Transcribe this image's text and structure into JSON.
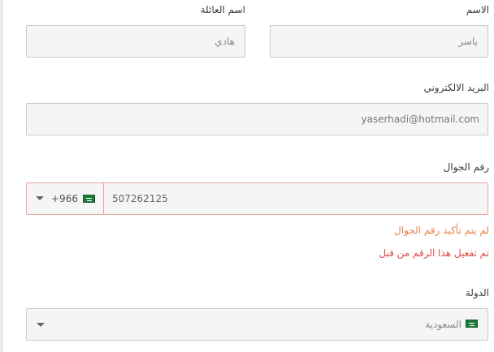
{
  "form": {
    "first_name": {
      "label": "الاسم",
      "value": "ياسر"
    },
    "last_name": {
      "label": "اسم العائلة",
      "value": "هادي"
    },
    "email": {
      "label": "البريد الالكتروني",
      "value": "yaserhadi@hotmail.com"
    },
    "phone": {
      "label": "رقم الجوال",
      "value": "507262125",
      "country_code": "+966",
      "flag_icon": "saudi-flag-icon",
      "border_color": "#e6a4a4"
    },
    "messages": {
      "phone_unverified": "لم يتم تأكيد رقم الجوال",
      "phone_already_used": "تم تفعيل هذا الرقم من قبل"
    },
    "country": {
      "label": "الدولة",
      "value": "السعودية",
      "flag_icon": "saudi-flag-icon"
    }
  },
  "colors": {
    "warning": "#e8804a",
    "error": "#dc4a4a",
    "field_bg": "#f5f5f5",
    "field_border": "#c9c9c9"
  }
}
